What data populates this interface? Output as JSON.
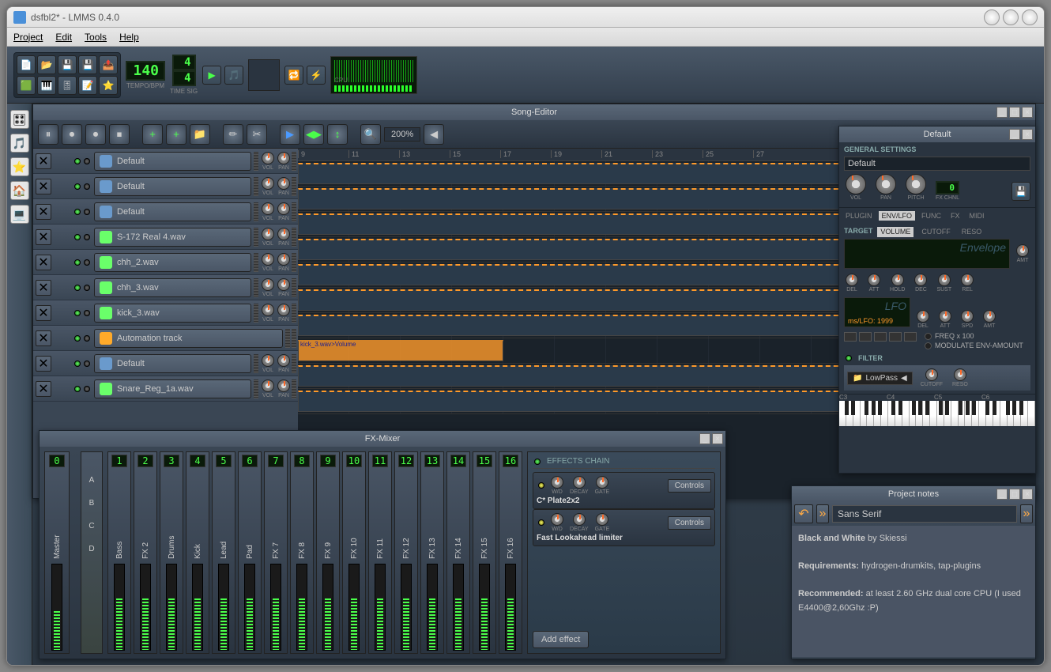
{
  "window": {
    "title": "dsfbl2* - LMMS 0.4.0"
  },
  "menu": [
    "Project",
    "Edit",
    "Tools",
    "Help"
  ],
  "toolbar": {
    "tempo": "140",
    "tempo_label": "TEMPO/BPM",
    "timesig_num": "4",
    "timesig_den": "4",
    "timesig_label": "TIME SIG",
    "cpu_label": "CPU"
  },
  "song_editor": {
    "title": "Song-Editor",
    "zoom": "200%",
    "timeline_start": 9,
    "timeline_step": 2,
    "timeline_count": 10,
    "tracks": [
      {
        "name": "Default",
        "icon": "synth",
        "vol": true,
        "pan": true
      },
      {
        "name": "Default",
        "icon": "sample",
        "vol": true,
        "pan": true
      },
      {
        "name": "Default",
        "icon": "sample",
        "vol": true,
        "pan": true
      },
      {
        "name": "S-172 Real 4.wav",
        "icon": "note",
        "vol": true,
        "pan": true
      },
      {
        "name": "chh_2.wav",
        "icon": "note",
        "vol": true,
        "pan": true
      },
      {
        "name": "chh_3.wav",
        "icon": "note",
        "vol": true,
        "pan": true
      },
      {
        "name": "kick_3.wav",
        "icon": "note",
        "vol": true,
        "pan": true
      },
      {
        "name": "Automation track",
        "icon": "folder",
        "vol": false,
        "pan": false,
        "automation": true,
        "auto_label": "kick_3.wav>Volume"
      },
      {
        "name": "Default",
        "icon": "synth",
        "vol": true,
        "pan": true
      },
      {
        "name": "Snare_Reg_1a.wav",
        "icon": "note",
        "vol": true,
        "pan": true
      }
    ],
    "knob_labels": {
      "vol": "VOL",
      "pan": "PAN"
    }
  },
  "instrument": {
    "title": "Default",
    "general": "GENERAL SETTINGS",
    "name": "Default",
    "main_knobs": [
      {
        "l": "VOL"
      },
      {
        "l": "PAN"
      },
      {
        "l": "PITCH"
      }
    ],
    "fxchnl_label": "FX CHNL",
    "fxchnl": "0",
    "tabs": [
      "PLUGIN",
      "ENV/LFO",
      "FUNC",
      "FX",
      "MIDI"
    ],
    "active_tab": 1,
    "target_label": "TARGET",
    "target_tabs": [
      "VOLUME",
      "CUTOFF",
      "RESO"
    ],
    "target_active": 0,
    "env_label": "Envelope",
    "env_amt": "AMT",
    "env_knobs": [
      "DEL",
      "ATT",
      "HOLD",
      "DEC",
      "SUST",
      "REL"
    ],
    "lfo_label": "LFO",
    "lfo_val": "ms/LFO: 1999",
    "lfo_knobs": [
      "DEL",
      "ATT",
      "SPD",
      "AMT"
    ],
    "freq_label": "FREQ x 100",
    "mod_label": "MODULATE ENV-AMOUNT",
    "filter_label": "FILTER",
    "filter_type": "LowPass",
    "filter_knobs": [
      "CUTOFF",
      "RESO"
    ],
    "octaves": [
      "C3",
      "C4",
      "C5",
      "C6"
    ]
  },
  "fx_mixer": {
    "title": "FX-Mixer",
    "sends": [
      "A",
      "B",
      "C",
      "D"
    ],
    "master": {
      "n": "0",
      "name": "Master",
      "level": 45
    },
    "strips": [
      {
        "n": "1",
        "name": "Bass",
        "level": 60
      },
      {
        "n": "2",
        "name": "FX 2",
        "level": 60
      },
      {
        "n": "3",
        "name": "Drums",
        "level": 60
      },
      {
        "n": "4",
        "name": "Kick",
        "level": 60
      },
      {
        "n": "5",
        "name": "Lead",
        "level": 60
      },
      {
        "n": "6",
        "name": "Pad",
        "level": 60
      },
      {
        "n": "7",
        "name": "FX 7",
        "level": 60
      },
      {
        "n": "8",
        "name": "FX 8",
        "level": 60
      },
      {
        "n": "9",
        "name": "FX 9",
        "level": 60
      },
      {
        "n": "10",
        "name": "FX 10",
        "level": 60
      },
      {
        "n": "11",
        "name": "FX 11",
        "level": 60
      },
      {
        "n": "12",
        "name": "FX 12",
        "level": 60
      },
      {
        "n": "13",
        "name": "FX 13",
        "level": 60
      },
      {
        "n": "14",
        "name": "FX 14",
        "level": 60
      },
      {
        "n": "15",
        "name": "FX 15",
        "level": 60
      },
      {
        "n": "16",
        "name": "FX 16",
        "level": 60
      }
    ],
    "chain_label": "EFFECTS CHAIN",
    "effects": [
      {
        "name": "C* Plate2x2",
        "knobs": [
          "W/D",
          "DECAY",
          "GATE"
        ],
        "ctrl": "Controls"
      },
      {
        "name": "Fast Lookahead limiter",
        "knobs": [
          "W/D",
          "DECAY",
          "GATE"
        ],
        "ctrl": "Controls"
      }
    ],
    "add_label": "Add effect"
  },
  "notes": {
    "title": "Project notes",
    "font": "Sans Serif",
    "body_title": "Black and White",
    "by": " by Skiessi",
    "req_lbl": "Requirements:",
    "req": " hydrogen-drumkits, tap-plugins",
    "rec_lbl": "Recommended:",
    "rec": " at least 2.60 GHz dual core CPU (I used E4400@2,60Ghz :P)"
  }
}
